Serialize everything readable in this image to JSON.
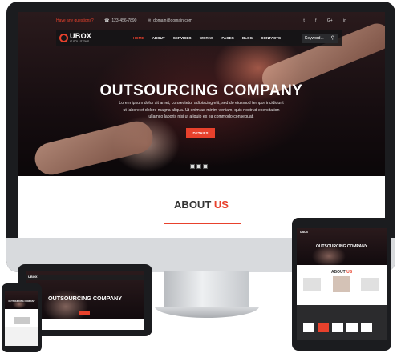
{
  "colors": {
    "accent": "#e8412c",
    "dark": "#1b1c1f"
  },
  "topbar": {
    "question": "Have any questions?",
    "phone": "123-456-7890",
    "email": "domain@domain.com",
    "icons": [
      "twitter-icon",
      "facebook-icon",
      "google-plus-icon",
      "linkedin-icon"
    ],
    "social_glyphs": [
      "t",
      "f",
      "G+",
      "in"
    ]
  },
  "brand": {
    "name": "UBOX",
    "tagline": "IT SOLUTIONS"
  },
  "nav": {
    "items": [
      "HOME",
      "ABOUT",
      "SERVICES",
      "WORKS",
      "PAGES",
      "BLOG",
      "CONTACTS"
    ],
    "active": "HOME",
    "search_placeholder": "Keyword..."
  },
  "hero": {
    "title": "OUTSOURCING COMPANY",
    "text": "Lorem ipsum dolor sit amet, consectetur adipiscing elit, sed do eiusmod tempor incididunt ut labore et dolore magna aliqua. Ut enim ad minim veniam, quis nostrud exercitation ullamco laboris nisi ut aliquip ex ea commodo consequat.",
    "button": "DETAILS",
    "slide_count": 3
  },
  "about": {
    "title_main": "ABOUT",
    "title_accent": "US"
  },
  "tablet": {
    "title": "OUTSOURCING COMPANY",
    "brand": "UBOX"
  },
  "tablet_portrait": {
    "title": "OUTSOURCING COMPANY",
    "about_main": "ABOUT",
    "about_accent": "US",
    "brand": "UBOX"
  },
  "phone": {
    "title": "OUTSOURCING COMPANY"
  }
}
